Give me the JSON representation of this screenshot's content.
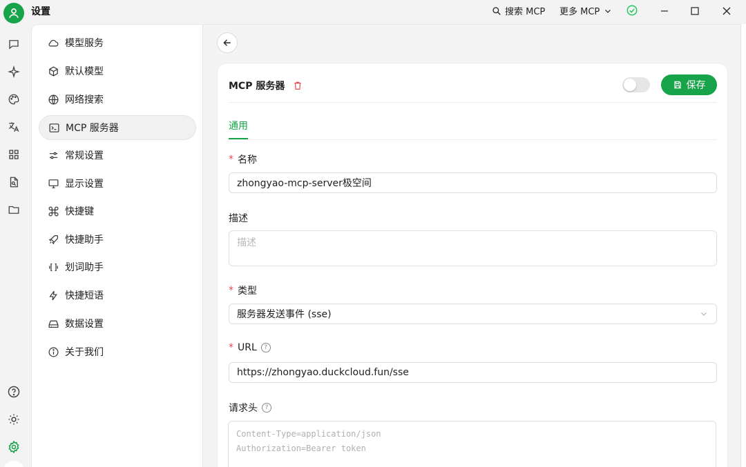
{
  "window": {
    "title": "设置",
    "search_label": "搜索 MCP",
    "more_label": "更多 MCP"
  },
  "nav": {
    "items": [
      {
        "label": "模型服务",
        "icon": "cloud-icon"
      },
      {
        "label": "默认模型",
        "icon": "cube-icon"
      },
      {
        "label": "网络搜索",
        "icon": "globe-icon"
      },
      {
        "label": "MCP 服务器",
        "icon": "terminal-icon"
      },
      {
        "label": "常规设置",
        "icon": "sliders-icon"
      },
      {
        "label": "显示设置",
        "icon": "monitor-icon"
      },
      {
        "label": "快捷键",
        "icon": "command-icon"
      },
      {
        "label": "快捷助手",
        "icon": "rocket-icon"
      },
      {
        "label": "划词助手",
        "icon": "text-select-icon"
      },
      {
        "label": "快捷短语",
        "icon": "zap-icon"
      },
      {
        "label": "数据设置",
        "icon": "hard-drive-icon"
      },
      {
        "label": "关于我们",
        "icon": "info-icon"
      }
    ],
    "active_index": 3
  },
  "server": {
    "title": "MCP 服务器",
    "save_label": "保存",
    "enabled": false,
    "tab_general": "通用",
    "name_label": "名称",
    "name_value": "zhongyao-mcp-server极空间",
    "desc_label": "描述",
    "desc_placeholder": "描述",
    "type_label": "类型",
    "type_value": "服务器发送事件 (sse)",
    "url_label": "URL",
    "url_value": "https://zhongyao.duckcloud.fun/sse",
    "headers_label": "请求头",
    "headers_placeholder_line1": "Content-Type=application/json",
    "headers_placeholder_line2": "Authorization=Bearer token"
  },
  "colors": {
    "accent": "#16a34a",
    "required": "#e5484d",
    "delete": "#e5484d"
  }
}
